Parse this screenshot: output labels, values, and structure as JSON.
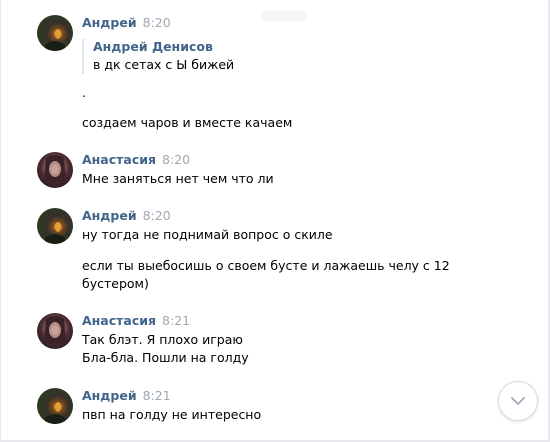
{
  "messages": [
    {
      "author": "Андрей",
      "time": "8:20",
      "avatar_icon": "user-avatar-andrey",
      "quote": {
        "author": "Андрей Денисов",
        "text": "в дк сетах с Ы бижей"
      },
      "lines": [
        ".",
        "создаем чаров и вместе качаем"
      ]
    },
    {
      "author": "Анастасия",
      "time": "8:20",
      "avatar_icon": "user-avatar-anastasia",
      "lines": [
        "Мне заняться нет чем что ли"
      ]
    },
    {
      "author": "Андрей",
      "time": "8:20",
      "avatar_icon": "user-avatar-andrey",
      "lines": [
        "ну тогда не поднимай вопрос о скиле",
        "если ты выебосишь о своем бусте и лажаешь челу с 12",
        "бустером)"
      ]
    },
    {
      "author": "Анастасия",
      "time": "8:21",
      "avatar_icon": "user-avatar-anastasia",
      "lines": [
        "Так блэт. Я плохо играю",
        "Бла-бла. Пошли на голду"
      ]
    },
    {
      "author": "Андрей",
      "time": "8:21",
      "avatar_icon": "user-avatar-andrey",
      "lines": [
        "пвп на голду не интересно"
      ]
    }
  ],
  "scroll_down": {
    "icon": "chevron-down-icon"
  },
  "colors": {
    "author": "#42648b",
    "time": "#a0a8b3",
    "text": "#000000"
  }
}
